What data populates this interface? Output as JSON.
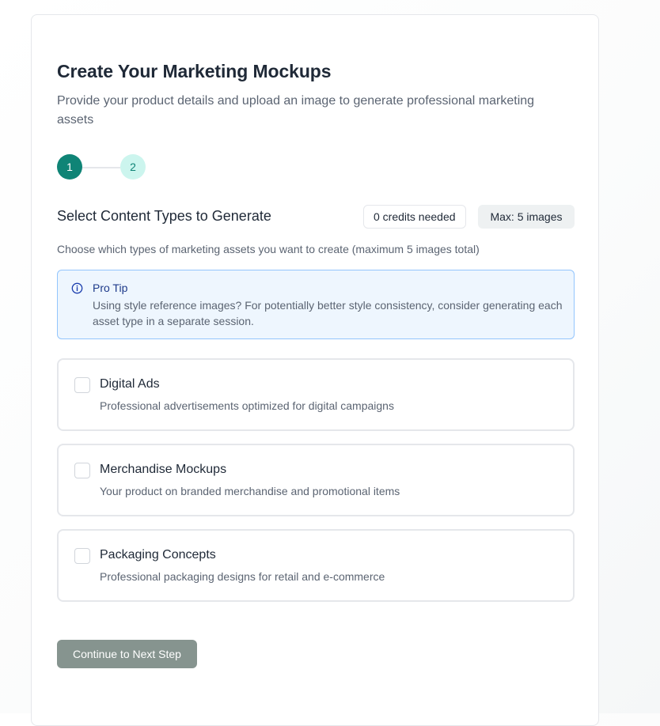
{
  "header": {
    "title": "Create Your Marketing Mockups",
    "subtitle": "Provide your product details and upload an image to generate professional marketing assets"
  },
  "stepper": {
    "current_step": 1,
    "steps": [
      {
        "label": "1",
        "state": "active"
      },
      {
        "label": "2",
        "state": "upcoming"
      }
    ]
  },
  "content_types": {
    "title": "Select Content Types to Generate",
    "credits_badge": "0 credits needed",
    "max_badge": "Max: 5 images",
    "description": "Choose which types of marketing assets you want to create (maximum 5 images total)",
    "options": [
      {
        "label": "Digital Ads",
        "description": "Professional advertisements optimized for digital campaigns",
        "checked": false
      },
      {
        "label": "Merchandise Mockups",
        "description": "Your product on branded merchandise and promotional items",
        "checked": false
      },
      {
        "label": "Packaging Concepts",
        "description": "Professional packaging designs for retail and e-commerce",
        "checked": false
      }
    ]
  },
  "pro_tip": {
    "icon": "info-icon",
    "title": "Pro Tip",
    "text": "Using style reference images? For potentially better style consistency, consider generating each asset type in a separate session."
  },
  "actions": {
    "continue_label": "Continue to Next Step",
    "continue_disabled": true
  },
  "colors": {
    "accent": "#0f8476",
    "accent_light": "#ccf5ee",
    "tip_background": "#eef6fe",
    "tip_border": "#93c5fd",
    "button_disabled": "#86948f"
  }
}
